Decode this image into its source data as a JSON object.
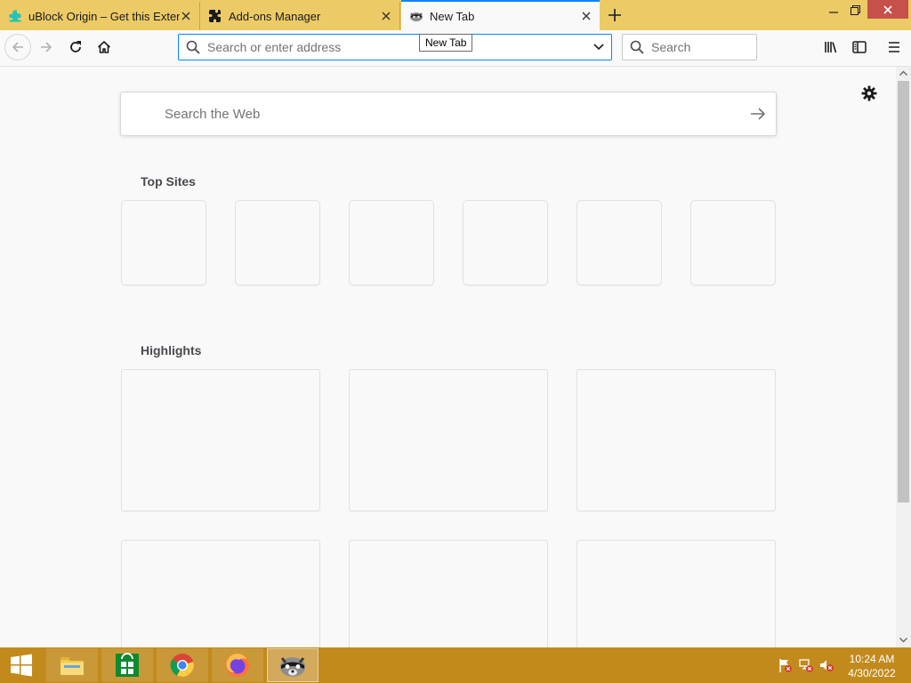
{
  "browser": {
    "tabs": [
      {
        "label": "uBlock Origin – Get this Extension for Firefox",
        "icon": "puzzle-teal-icon",
        "active": false
      },
      {
        "label": "Add-ons Manager",
        "icon": "puzzle-icon",
        "active": false
      },
      {
        "label": "New Tab",
        "icon": "raccoon-icon",
        "active": true
      }
    ],
    "tooltip": "New Tab",
    "urlbar": {
      "value": "",
      "placeholder": "Search or enter address"
    },
    "searchbar": {
      "value": "",
      "placeholder": "Search"
    }
  },
  "newtab": {
    "web_search": {
      "value": "",
      "placeholder": "Search the Web"
    },
    "top_sites_title": "Top Sites",
    "highlights_title": "Highlights",
    "top_sites_count": 6,
    "highlights_count": 6
  },
  "taskbar": {
    "apps": [
      "start-icon",
      "file-explorer-icon",
      "store-icon",
      "chrome-icon",
      "firefox-icon",
      "raccoon-app-icon"
    ],
    "clock": {
      "time": "10:24 AM",
      "date": "4/30/2022"
    }
  },
  "colors": {
    "accent": "#0a84ff",
    "tabstrip": "#eccb66",
    "taskbar": "#c28a1d",
    "close": "#c7504a"
  }
}
